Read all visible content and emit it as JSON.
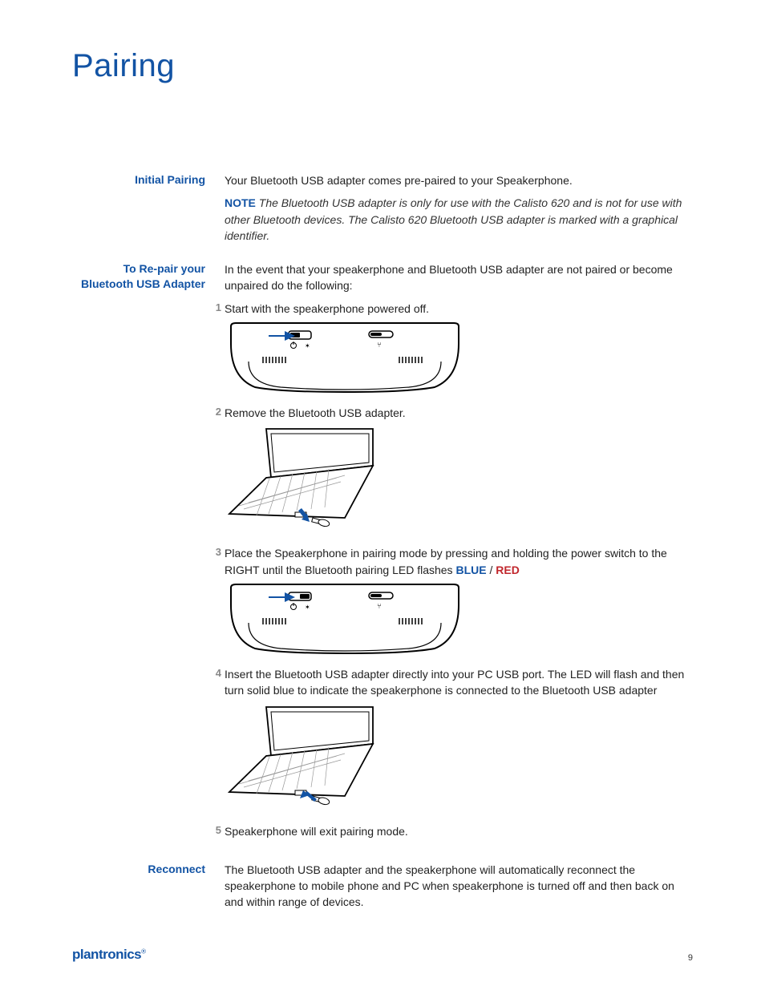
{
  "title": "Pairing",
  "sections": {
    "initial": {
      "label": "Initial Pairing",
      "p1": "Your Bluetooth USB adapter comes pre-paired to your Speakerphone.",
      "note_label": "NOTE",
      "note_text": "The Bluetooth USB adapter is only for use with the Calisto 620 and is not for use with other Bluetooth devices. The Calisto 620 Bluetooth USB adapter is marked with a graphical identifier."
    },
    "repair": {
      "label": "To Re-pair your Bluetooth USB Adapter",
      "intro": "In the event that your speakerphone and Bluetooth USB adapter are not paired or become unpaired do the following:",
      "step1": "Start with the speakerphone powered off.",
      "step2": "Remove the Bluetooth USB adapter.",
      "step3_pre": "Place the Speakerphone in pairing mode by pressing and holding the power switch to the RIGHT until the Bluetooth pairing LED flashes ",
      "step3_blue": "BLUE",
      "step3_sep": " / ",
      "step3_red": "RED",
      "step4": "Insert the Bluetooth USB adapter directly into your PC USB port. The LED will flash and then turn solid blue to indicate the speakerphone is connected to the Bluetooth USB adapter",
      "step5": "Speakerphone will exit pairing mode."
    },
    "reconnect": {
      "label": "Reconnect",
      "text": "The Bluetooth USB adapter and the speakerphone will automatically reconnect the speakerphone to mobile phone and PC when speakerphone is turned off and then back on and within range of devices."
    }
  },
  "footer": {
    "brand": "plantronics",
    "page": "9"
  }
}
